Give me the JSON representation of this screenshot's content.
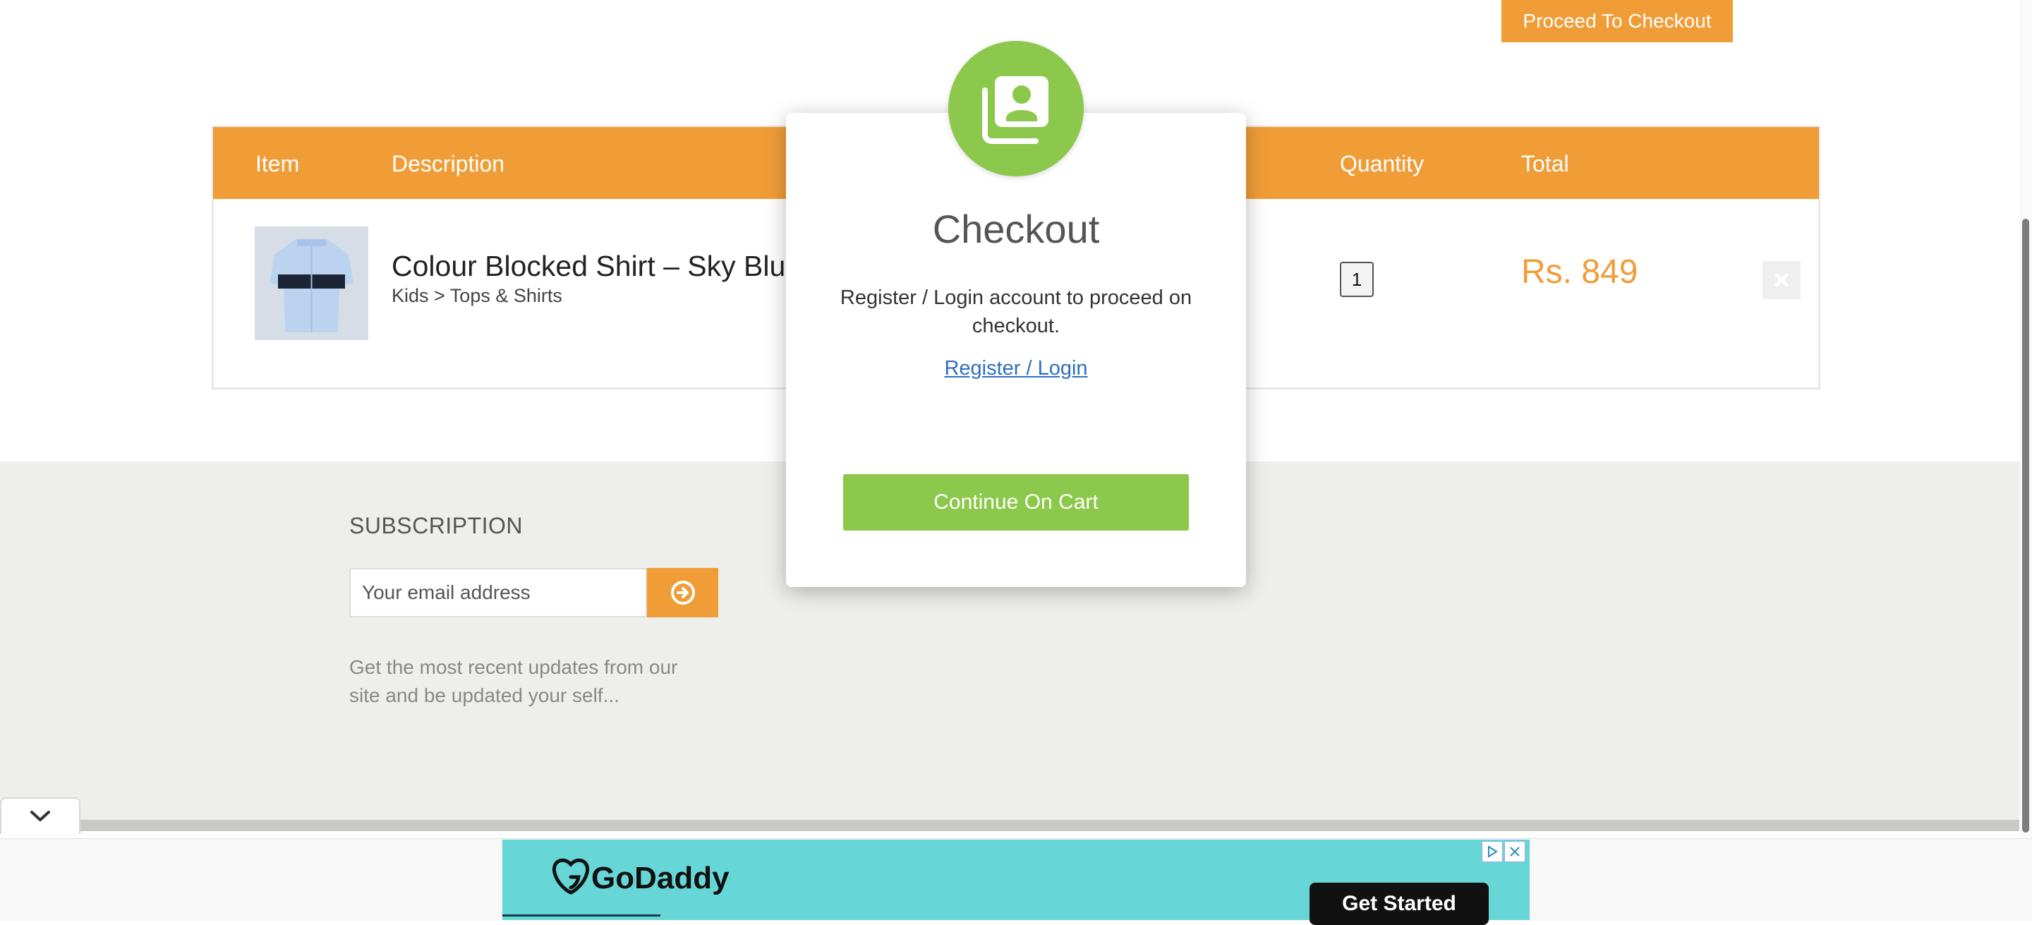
{
  "header": {
    "proceed_label": "Proceed To Checkout"
  },
  "cart": {
    "columns": {
      "item": "Item",
      "description": "Description",
      "quantity": "Quantity",
      "total": "Total"
    },
    "rows": [
      {
        "name": "Colour Blocked Shirt – Sky Blue",
        "category": "Kids > Tops & Shirts",
        "quantity": "1",
        "price": "Rs. 849"
      }
    ]
  },
  "footer": {
    "subscription_title": "SUBSCRIPTION",
    "email_placeholder": "Your email address",
    "description": "Get the most recent updates from our site and be updated your self..."
  },
  "modal": {
    "title": "Checkout",
    "message": "Register / Login account to proceed on checkout.",
    "link_label": "Register / Login",
    "continue_label": "Continue On Cart"
  },
  "ad": {
    "brand": "GoDaddy",
    "cta_label": "Get Started"
  },
  "colors": {
    "accent": "#f09d38",
    "green": "#8cc84b",
    "footer_bg": "#eeeeea",
    "ad_bg": "#66d7d6"
  }
}
